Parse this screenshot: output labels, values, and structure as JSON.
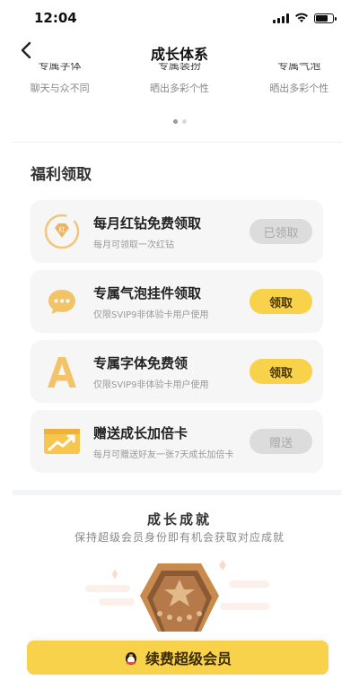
{
  "status": {
    "time": "12:04"
  },
  "nav": {
    "title": "成长体系"
  },
  "privileges": [
    {
      "title": "专属字体",
      "subtitle": "聊天与众不同"
    },
    {
      "title": "专属装扮",
      "subtitle": "晒出多彩个性"
    },
    {
      "title": "专属气泡",
      "subtitle": "晒出多彩个性"
    }
  ],
  "benefits": {
    "title": "福利领取",
    "items": [
      {
        "title": "每月红钻免费领取",
        "desc": "每月可领取一次红钻",
        "button": "已领取",
        "icon": "red-diamond-icon"
      },
      {
        "title": "专属气泡挂件领取",
        "desc": "仅限SVIP9非体验卡用户使用",
        "button": "领取",
        "icon": "chat-bubble-icon"
      },
      {
        "title": "专属字体免费领",
        "desc": "仅限SVIP9非体验卡用户使用",
        "button": "领取",
        "icon": "font-a-icon"
      },
      {
        "title": "赠送成长加倍卡",
        "desc": "每月可赠送好友一张7天成长加倍卡",
        "button": "赠送",
        "icon": "growth-card-icon"
      }
    ]
  },
  "growth": {
    "title": "成长成就",
    "subtitle": "保持超级会员身份即有机会获取对应成就"
  },
  "renew": {
    "label": "续费超级会员"
  },
  "colors": {
    "accent": "#f8d24a",
    "card_bg": "#f6f6f6",
    "disabled": "#dcdcdc"
  }
}
